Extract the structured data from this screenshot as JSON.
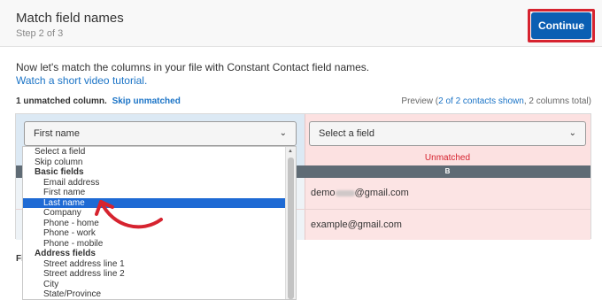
{
  "header": {
    "title": "Match field names",
    "step": "Step 2 of 3",
    "continue_label": "Continue"
  },
  "intro": {
    "text": "Now let's match the columns in your file with Constant Contact field names.",
    "tutorial_link": "Watch a short video tutorial."
  },
  "status": {
    "unmatched": "1 unmatched column.",
    "skip_label": "Skip unmatched",
    "preview_prefix": "Preview (",
    "preview_link": "2 of 2 contacts shown",
    "preview_suffix": ", 2 columns total)"
  },
  "table": {
    "column_a_select": "First name",
    "column_b_select": "Select a field",
    "column_b_status": "Unmatched",
    "column_b_header": "B",
    "rows": [
      {
        "b_prefix": "demo",
        "b_suffix": "@gmail.com"
      },
      {
        "b_value": "example@gmail.com"
      }
    ]
  },
  "cutoff_label": "Fi",
  "dropdown": {
    "options": [
      {
        "label": "Select a field",
        "type": "option"
      },
      {
        "label": "Skip column",
        "type": "option"
      },
      {
        "label": "Basic fields",
        "type": "group"
      },
      {
        "label": "Email address",
        "type": "indent"
      },
      {
        "label": "First name",
        "type": "indent"
      },
      {
        "label": "Last name",
        "type": "indent",
        "selected": true
      },
      {
        "label": "Company",
        "type": "indent"
      },
      {
        "label": "Phone - home",
        "type": "indent"
      },
      {
        "label": "Phone - work",
        "type": "indent"
      },
      {
        "label": "Phone - mobile",
        "type": "indent"
      },
      {
        "label": "Address fields",
        "type": "group"
      },
      {
        "label": "Street address line 1",
        "type": "indent"
      },
      {
        "label": "Street address line 2",
        "type": "indent"
      },
      {
        "label": "City",
        "type": "indent"
      },
      {
        "label": "State/Province",
        "type": "indent"
      }
    ]
  },
  "icons": {
    "select_chevron": "chevron-down-icon",
    "annotation": "red-curved-arrow-icon"
  },
  "colors": {
    "primary": "#0b5fb3",
    "highlight": "#d6232f",
    "link": "#1a73c6",
    "unmatched": "#d6232f",
    "selected_option": "#1e6ad4"
  }
}
